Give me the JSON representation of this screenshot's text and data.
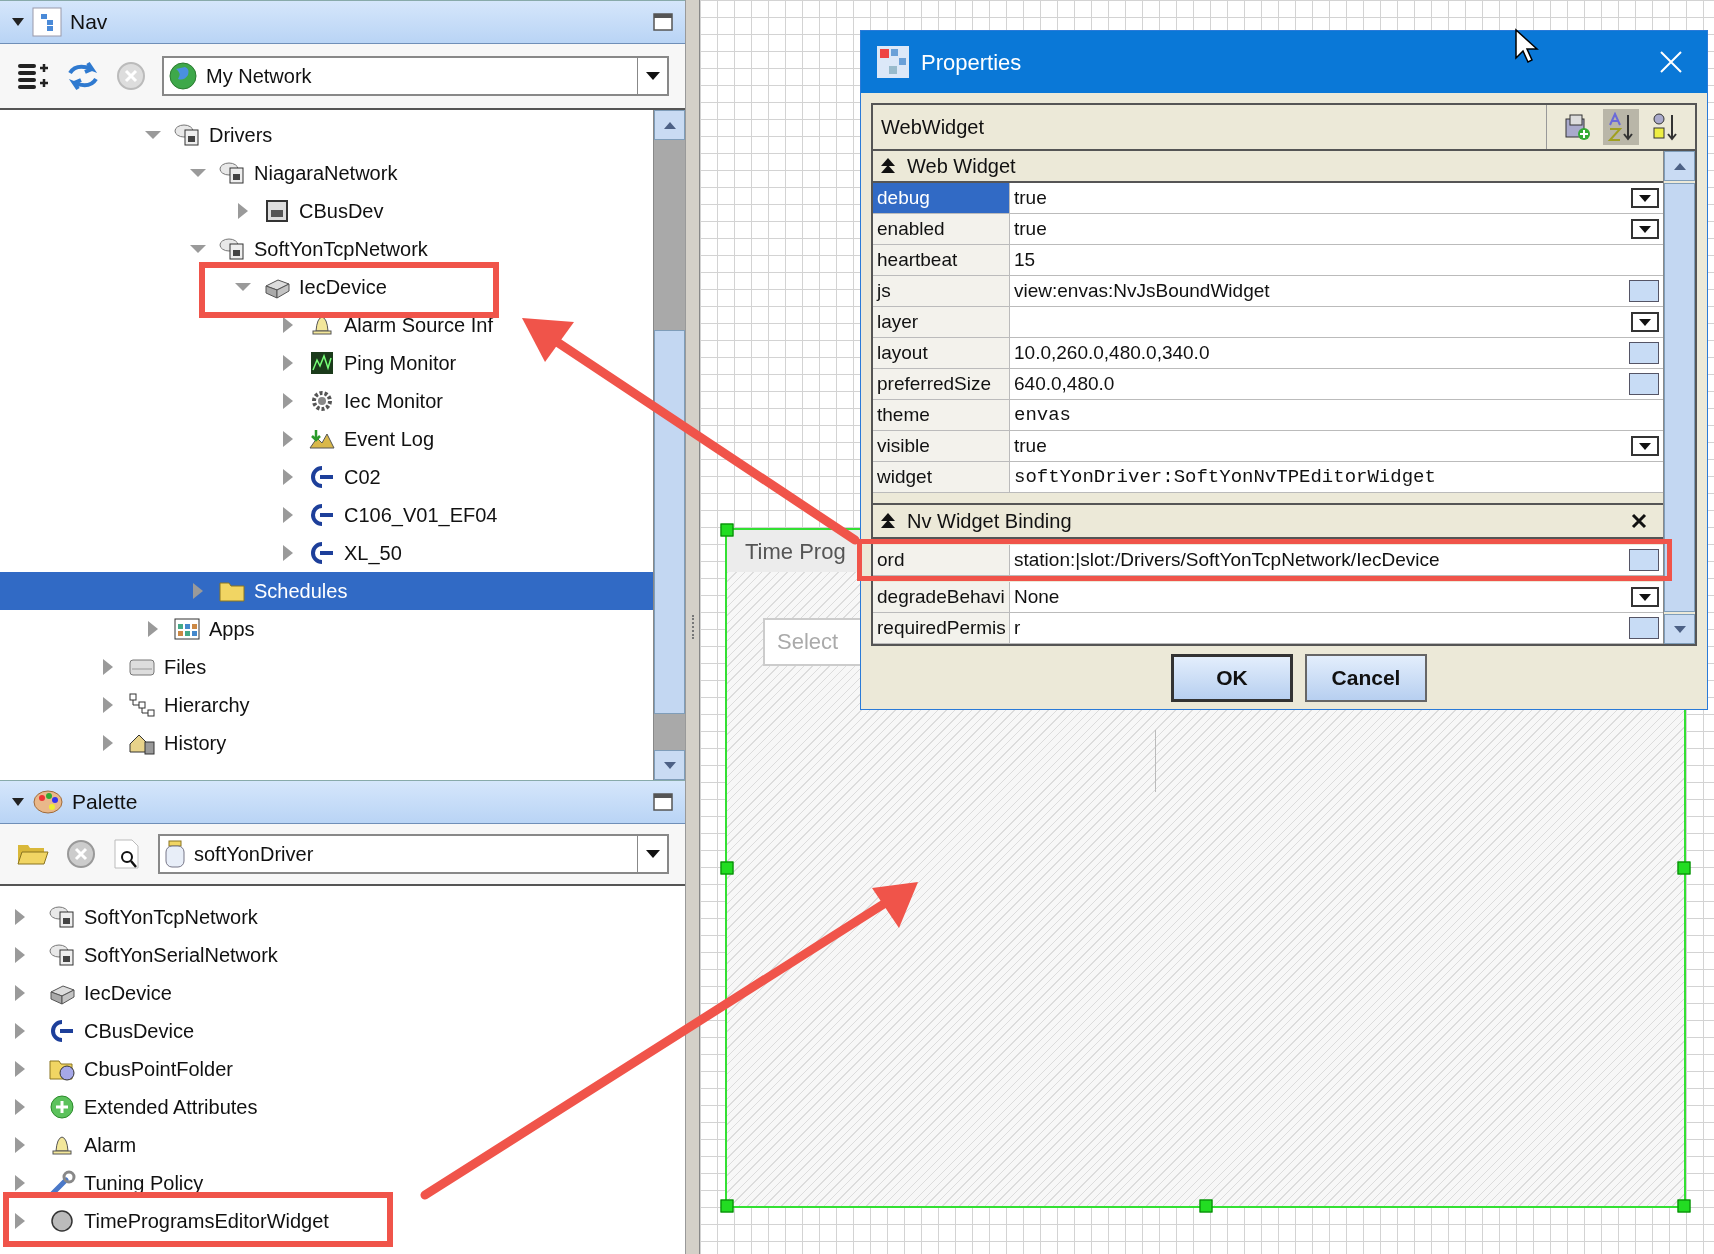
{
  "nav": {
    "title": "Nav",
    "location": "My Network",
    "tree_upper": [
      {
        "label": "Drivers",
        "kind": "network",
        "expanded": true,
        "selected": false,
        "children": [
          {
            "label": "NiagaraNetwork",
            "kind": "network",
            "expanded": true,
            "selected": false,
            "children": [
              {
                "label": "CBusDev",
                "kind": "device",
                "expanded": false,
                "selected": false
              }
            ]
          },
          {
            "label": "SoftYonTcpNetwork",
            "kind": "network",
            "expanded": true,
            "selected": false,
            "children": [
              {
                "label": "IecDevice",
                "kind": "iec",
                "expanded": true,
                "selected": false,
                "children": [
                  {
                    "label": "Alarm Source Inf",
                    "kind": "bell",
                    "expanded": false,
                    "selected": false
                  },
                  {
                    "label": "Ping Monitor",
                    "kind": "chart",
                    "expanded": false,
                    "selected": false
                  },
                  {
                    "label": "Iec Monitor",
                    "kind": "gear",
                    "expanded": false,
                    "selected": false
                  },
                  {
                    "label": "Event Log",
                    "kind": "eventlog",
                    "expanded": false,
                    "selected": false
                  },
                  {
                    "label": "C02",
                    "kind": "cbus",
                    "expanded": false,
                    "selected": false
                  },
                  {
                    "label": "C106_V01_EF04",
                    "kind": "cbus",
                    "expanded": false,
                    "selected": false
                  },
                  {
                    "label": "XL_50",
                    "kind": "cbus",
                    "expanded": false,
                    "selected": false
                  }
                ]
              }
            ]
          },
          {
            "label": "Schedules",
            "kind": "folder",
            "expanded": false,
            "selected": true
          }
        ]
      },
      {
        "label": "Apps",
        "kind": "apps",
        "expanded": false,
        "selected": false
      }
    ],
    "tree_lower": [
      {
        "label": "Files",
        "kind": "files",
        "expanded": false,
        "selected": false
      },
      {
        "label": "Hierarchy",
        "kind": "hierarchy",
        "expanded": false,
        "selected": false
      },
      {
        "label": "History",
        "kind": "history",
        "expanded": false,
        "selected": false
      }
    ]
  },
  "palette": {
    "title": "Palette",
    "module": "softYonDriver",
    "items": [
      {
        "label": "SoftYonTcpNetwork",
        "kind": "network"
      },
      {
        "label": "SoftYonSerialNetwork",
        "kind": "network"
      },
      {
        "label": "IecDevice",
        "kind": "iec"
      },
      {
        "label": "CBusDevice",
        "kind": "cbus"
      },
      {
        "label": "CbusPointFolder",
        "kind": "pointfolder"
      },
      {
        "label": "Extended Attributes",
        "kind": "extattr"
      },
      {
        "label": "Alarm",
        "kind": "bell"
      },
      {
        "label": "Tuning Policy",
        "kind": "wrench"
      },
      {
        "label": "TimeProgramsEditorWidget",
        "kind": "widget"
      }
    ]
  },
  "canvas": {
    "widget": {
      "title": "Time Prog",
      "placeholder": "Select"
    }
  },
  "dialog": {
    "title": "Properties",
    "object": "WebWidget",
    "toolbar_buttons": [
      {
        "selected": false
      },
      {
        "selected": true
      },
      {
        "selected": false
      }
    ],
    "sections": [
      {
        "title": "Web Widget",
        "closable": false,
        "rows": [
          {
            "name": "debug",
            "value": "true",
            "kind": "dropdown",
            "selected": true
          },
          {
            "name": "enabled",
            "value": "true",
            "kind": "dropdown",
            "selected": false
          },
          {
            "name": "heartbeat",
            "value": "15",
            "kind": "plain",
            "selected": false
          },
          {
            "name": "js",
            "value": "view:envas:NvJsBoundWidget",
            "kind": "button",
            "selected": false
          },
          {
            "name": "layer",
            "kind": "dropdown",
            "selected": false
          },
          {
            "name": "layout",
            "value": "10.0,260.0,480.0,340.0",
            "kind": "button",
            "selected": false
          },
          {
            "name": "preferredSize",
            "value": "640.0,480.0",
            "kind": "button",
            "selected": false
          },
          {
            "name": "theme",
            "value": "envas",
            "kind": "plain",
            "literal": true,
            "selected": false
          },
          {
            "name": "visible",
            "value": "true",
            "kind": "dropdown",
            "selected": false
          },
          {
            "name": "widget",
            "value": "softYonDriver:SoftYonNvTPEditorWidget",
            "kind": "plain",
            "literal": true,
            "selected": false
          }
        ]
      },
      {
        "title": "Nv Widget Binding",
        "closable": true,
        "rows": [
          {
            "name": "ord",
            "value": "station:|slot:/Drivers/SoftYonTcpNetwork/IecDevice",
            "kind": "button",
            "selected": false
          },
          {
            "name": "degradeBehavi",
            "value": "None",
            "kind": "dropdown",
            "selected": false
          },
          {
            "name": "requiredPermis",
            "value": "r",
            "kind": "button",
            "selected": false
          }
        ]
      }
    ],
    "buttons": [
      {
        "label": "OK",
        "default": true
      },
      {
        "label": "Cancel",
        "default": false
      }
    ]
  }
}
